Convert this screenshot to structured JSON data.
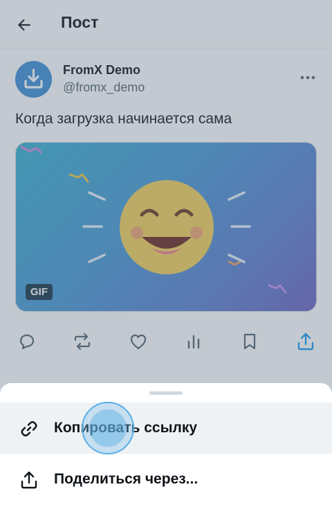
{
  "header": {
    "title": "Пост"
  },
  "post": {
    "author_name": "FromX Demo",
    "author_handle": "@fromx_demo",
    "text": "Когда загрузка начинается сама",
    "media": {
      "badge": "GIF"
    }
  },
  "sheet": {
    "items": [
      {
        "label": "Копировать ссылку",
        "icon": "link-icon"
      },
      {
        "label": "Поделиться через...",
        "icon": "share-icon"
      }
    ]
  },
  "colors": {
    "accent": "#1d9bf0",
    "avatar": "#3d8fd6",
    "overlay": "rgba(88,106,126,0.36)"
  }
}
